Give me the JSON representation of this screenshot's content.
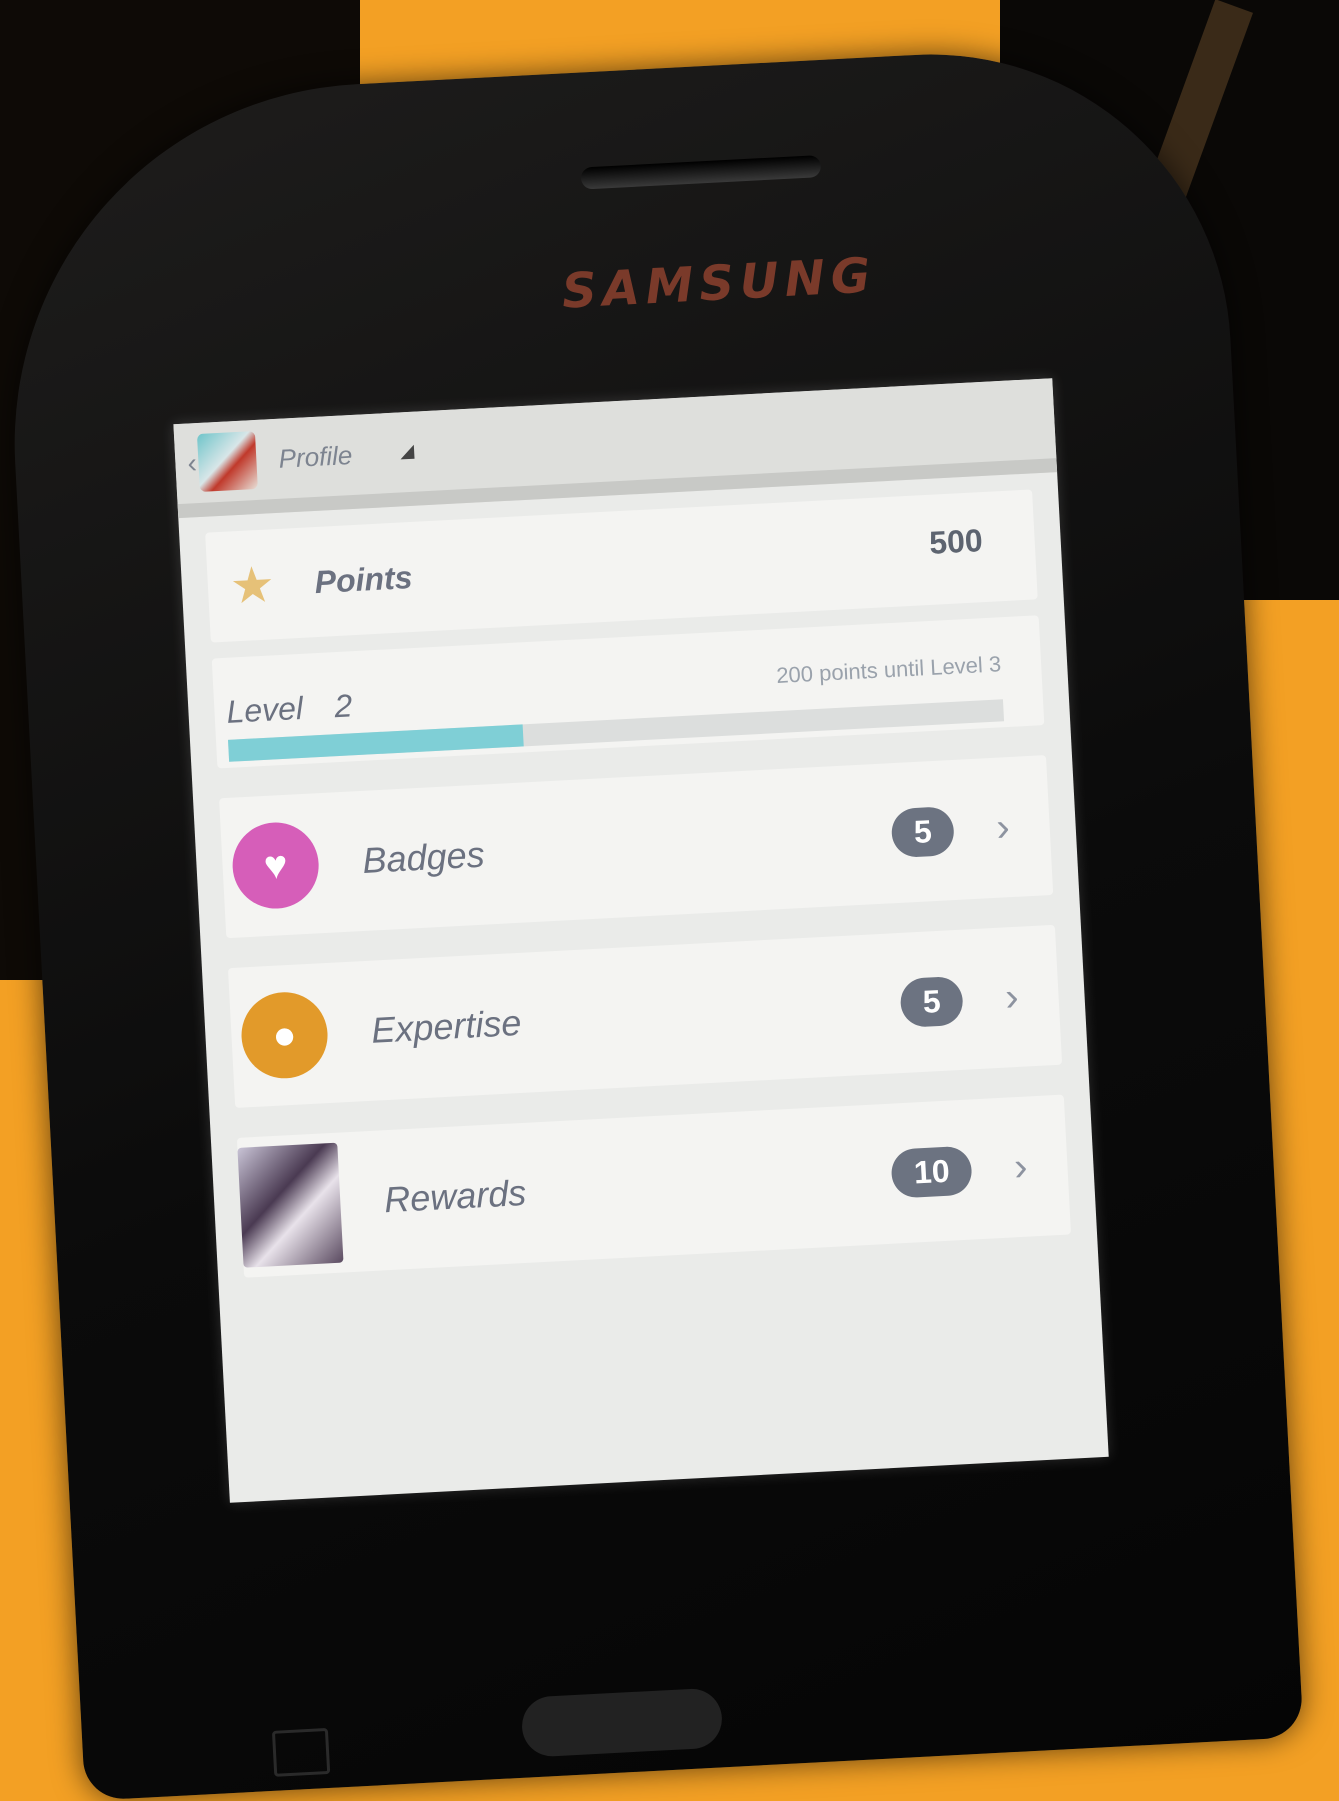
{
  "device": {
    "brand": "SAMSUNG"
  },
  "appbar": {
    "title": "Profile",
    "back_icon": "‹"
  },
  "points": {
    "icon": "★",
    "label": "Points",
    "value": "500"
  },
  "level": {
    "label": "Level",
    "number": "2",
    "until_text": "200 points until Level 3",
    "progress_fraction": 0.38
  },
  "items": [
    {
      "icon": "♥",
      "label": "Badges",
      "count": "5",
      "chevron": "›"
    },
    {
      "icon": "●",
      "label": "Expertise",
      "count": "5",
      "chevron": "›"
    },
    {
      "label": "Rewards",
      "count": "10",
      "chevron": "›"
    }
  ],
  "colors": {
    "accent_progress": "#7fcfd6",
    "badge_bg": "#6c7381",
    "badges_icon": "#d65eb9",
    "expertise_icon": "#e29a2a",
    "star": "#e6c178"
  }
}
